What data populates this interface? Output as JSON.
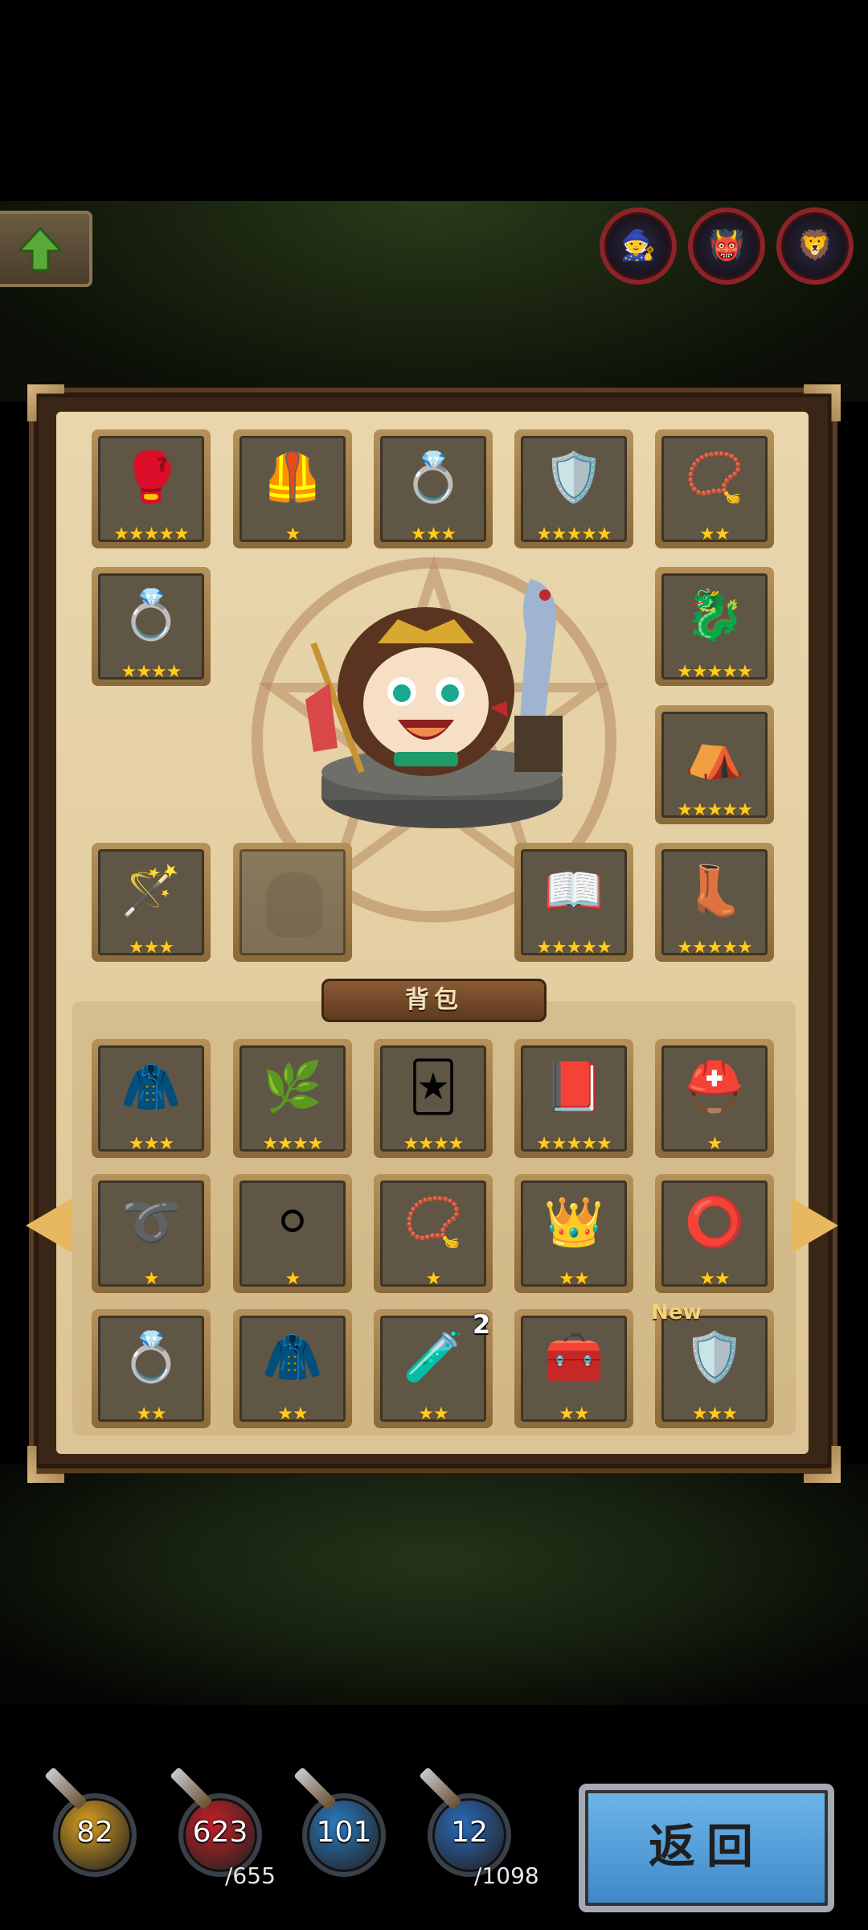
{
  "header": {
    "up_icon": "arrow-up-icon",
    "top_icons": [
      "hero-portrait-1-icon",
      "hero-portrait-2-icon",
      "hero-portrait-3-icon"
    ]
  },
  "equipment": {
    "slots": [
      {
        "item": "gauntlet-icon",
        "stars": "★★★★★"
      },
      {
        "item": "chest-armor-icon",
        "stars": "★"
      },
      {
        "item": "gold-ring-icon",
        "stars": "★★★"
      },
      {
        "item": "armor-set-icon",
        "stars": "★★★★★"
      },
      {
        "item": "amulet-icon",
        "stars": "★★"
      },
      {
        "item": "jeweled-ring-icon",
        "stars": "★★★★"
      },
      {
        "item": "dragon-ring-icon",
        "stars": "★★★★★"
      },
      {
        "item": "purple-cloak-icon",
        "stars": "★★★★★"
      },
      {
        "item": "scepter-icon",
        "stars": "★★★"
      },
      {
        "item": "empty-slot-icon",
        "stars": ""
      },
      {
        "item": "spellbook-icon",
        "stars": "★★★★★"
      },
      {
        "item": "boots-icon",
        "stars": "★★★★★"
      }
    ]
  },
  "bag": {
    "title": "背包",
    "new_label": "New",
    "quantity": "2",
    "items": [
      {
        "item": "blue-cloak-icon",
        "stars": "★★★"
      },
      {
        "item": "leaf-helmet-icon",
        "stars": "★★★★"
      },
      {
        "item": "card-icon",
        "stars": "★★★★"
      },
      {
        "item": "book-icon",
        "stars": "★★★★★"
      },
      {
        "item": "horned-helmet-icon",
        "stars": "★"
      },
      {
        "item": "belt-icon",
        "stars": "★"
      },
      {
        "item": "silver-belt-icon",
        "stars": "★"
      },
      {
        "item": "necklace-icon",
        "stars": "★"
      },
      {
        "item": "crown-helmet-icon",
        "stars": "★★"
      },
      {
        "item": "rune-ring-icon",
        "stars": "★★"
      },
      {
        "item": "silver-ring-icon",
        "stars": "★★"
      },
      {
        "item": "green-cloak-icon",
        "stars": "★★"
      },
      {
        "item": "potion-icon",
        "stars": "★★"
      },
      {
        "item": "treasure-chest-icon",
        "stars": "★★"
      },
      {
        "item": "plate-armor-icon",
        "stars": "★★★"
      }
    ]
  },
  "resources": [
    {
      "name": "gold",
      "value": "82",
      "max": "",
      "color": "#d9a020"
    },
    {
      "name": "health",
      "value": "623",
      "max": "/655",
      "color": "#c42028"
    },
    {
      "name": "mana",
      "value": "101",
      "max": "",
      "color": "#2a7ac0"
    },
    {
      "name": "exp",
      "value": "12",
      "max": "/1098",
      "color": "#2a6ab8"
    }
  ],
  "back_button": {
    "label": "返回"
  }
}
